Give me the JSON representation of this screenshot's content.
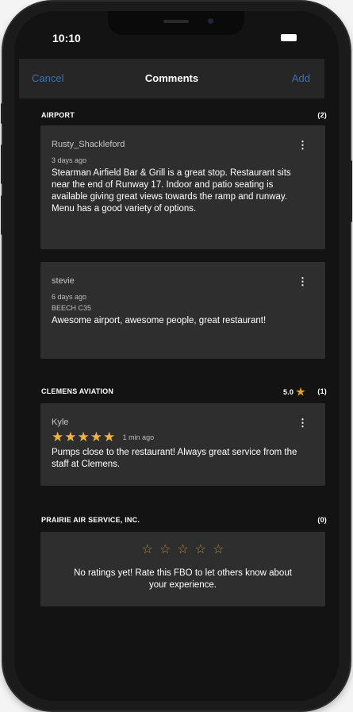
{
  "status": {
    "time": "10:10"
  },
  "nav": {
    "cancel": "Cancel",
    "title": "Comments",
    "add": "Add"
  },
  "sections": [
    {
      "name": "AIRPORT",
      "count": "(2)",
      "comments": [
        {
          "author": "Rusty_Shackleford",
          "time": "3 days ago",
          "text": "Stearman Airfield Bar & Grill is a great stop. Restaurant sits near the end of Runway 17. Indoor and patio seating is available giving great views towards the ramp and runway. Menu has a good variety of options."
        },
        {
          "author": "stevie",
          "time": "6 days ago",
          "aircraft": "BEECH C35",
          "text": "Awesome airport, awesome people, great restaurant!"
        }
      ]
    },
    {
      "name": "CLEMENS AVIATION",
      "rating": "5.0",
      "count": "(1)",
      "comments": [
        {
          "author": "Kyle",
          "stars": 5,
          "stars_text": "★★★★★",
          "time": "1 min ago",
          "text": "Pumps close to the restaurant!  Always great service from the staff at Clemens."
        }
      ]
    },
    {
      "name": "PRAIRIE AIR SERVICE, INC.",
      "count": "(0)",
      "empty": {
        "stars_text": "☆☆☆☆☆",
        "message": "No ratings yet! Rate this FBO to let others know about your experience."
      }
    }
  ],
  "icons": {
    "menu": "more-vertical-icon",
    "star": "star-icon"
  },
  "colors": {
    "accent": "#3a6fb3",
    "star": "#f0b43a",
    "card": "#2e2e2e",
    "background": "#131313"
  }
}
